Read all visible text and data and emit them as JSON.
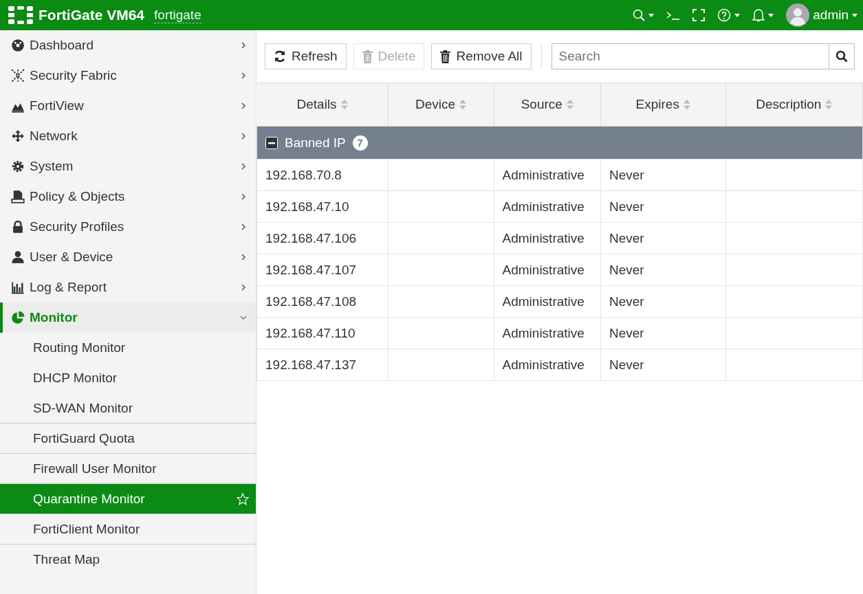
{
  "header": {
    "product": "FortiGate VM64",
    "hostname": "fortigate",
    "user": "admin"
  },
  "sidebar": {
    "items": [
      {
        "label": "Dashboard",
        "expanded": false,
        "selected": false
      },
      {
        "label": "Security Fabric",
        "expanded": false,
        "selected": false
      },
      {
        "label": "FortiView",
        "expanded": false,
        "selected": false
      },
      {
        "label": "Network",
        "expanded": false,
        "selected": false
      },
      {
        "label": "System",
        "expanded": false,
        "selected": false
      },
      {
        "label": "Policy & Objects",
        "expanded": false,
        "selected": false
      },
      {
        "label": "Security Profiles",
        "expanded": false,
        "selected": false
      },
      {
        "label": "User & Device",
        "expanded": false,
        "selected": false
      },
      {
        "label": "Log & Report",
        "expanded": false,
        "selected": false
      },
      {
        "label": "Monitor",
        "expanded": true,
        "selected": true,
        "children": [
          {
            "label": "Routing Monitor",
            "selected": false
          },
          {
            "label": "DHCP Monitor",
            "selected": false
          },
          {
            "label": "SD-WAN Monitor",
            "selected": false
          },
          {
            "label": "FortiGuard Quota",
            "selected": false
          },
          {
            "label": "Firewall User Monitor",
            "selected": false
          },
          {
            "label": "Quarantine Monitor",
            "selected": true
          },
          {
            "label": "FortiClient Monitor",
            "selected": false
          },
          {
            "label": "Threat Map",
            "selected": false
          }
        ]
      }
    ]
  },
  "toolbar": {
    "buttons": [
      {
        "label": "Refresh",
        "kind": "refresh",
        "disabled": false
      },
      {
        "label": "Delete",
        "kind": "delete",
        "disabled": true
      },
      {
        "label": "Remove All",
        "kind": "remove",
        "disabled": false
      }
    ],
    "search": {
      "placeholder": "Search"
    }
  },
  "table": {
    "columns": [
      "Details",
      "Device",
      "Source",
      "Expires",
      "Description"
    ],
    "group": {
      "label": "Banned IP",
      "count": "7",
      "expanded": true
    },
    "rows": [
      [
        "192.168.70.8",
        "",
        "Administrative",
        "Never",
        ""
      ],
      [
        "192.168.47.10",
        "",
        "Administrative",
        "Never",
        ""
      ],
      [
        "192.168.47.106",
        "",
        "Administrative",
        "Never",
        ""
      ],
      [
        "192.168.47.107",
        "",
        "Administrative",
        "Never",
        ""
      ],
      [
        "192.168.47.108",
        "",
        "Administrative",
        "Never",
        ""
      ],
      [
        "192.168.47.110",
        "",
        "Administrative",
        "Never",
        ""
      ],
      [
        "192.168.47.137",
        "",
        "Administrative",
        "Never",
        ""
      ]
    ]
  }
}
